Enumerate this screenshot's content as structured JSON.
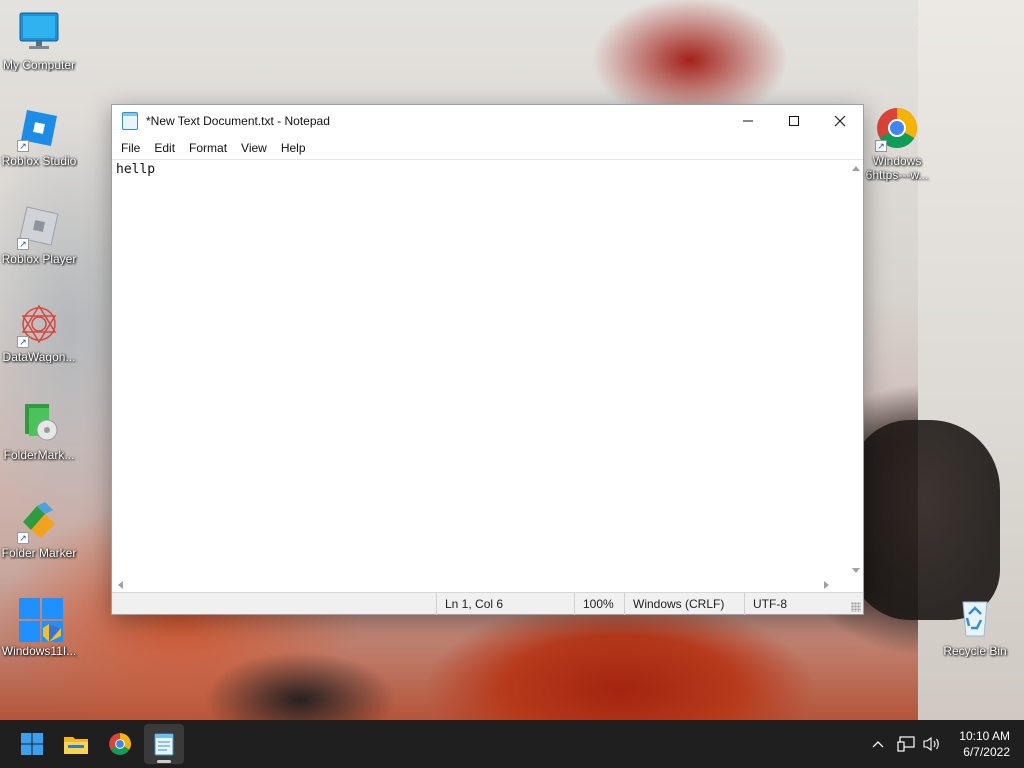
{
  "desktop": {
    "icons_left": [
      {
        "label": "My Computer",
        "icon": "monitor-icon"
      },
      {
        "label": "Roblox Studio",
        "icon": "roblox-studio-icon"
      },
      {
        "label": "Roblox Player",
        "icon": "roblox-player-icon"
      },
      {
        "label": "DataWagon...",
        "icon": "datawagon-icon"
      },
      {
        "label": "FolderMark...",
        "icon": "foldermarker-icon"
      },
      {
        "label": "Folder Marker",
        "icon": "folder-marker-icon"
      },
      {
        "label": "Windows11I...",
        "icon": "windows-logo-icon"
      }
    ],
    "icons_right": [
      {
        "label_line1": "Windows",
        "label_line2": "6https---w...",
        "icon": "chrome-icon"
      },
      {
        "label": "Recycle Bin",
        "icon": "recycle-bin-icon"
      }
    ]
  },
  "notepad": {
    "title": "*New Text Document.txt - Notepad",
    "menu": [
      "File",
      "Edit",
      "Format",
      "View",
      "Help"
    ],
    "content": "hellp",
    "status": {
      "position": "Ln 1, Col 6",
      "zoom": "100%",
      "line_ending": "Windows (CRLF)",
      "encoding": "UTF-8"
    }
  },
  "taskbar": {
    "apps": [
      "start-icon",
      "file-explorer-icon",
      "chrome-icon",
      "notepad-icon"
    ],
    "active_app": "notepad-icon",
    "tray_icons": [
      "chevron-up-icon",
      "network-icon",
      "speaker-icon"
    ],
    "time": "10:10 AM",
    "date": "6/7/2022"
  },
  "colors": {
    "taskbar_bg": "#1f1f1f",
    "chrome_red": "#db4437",
    "chrome_yellow": "#f4b400",
    "chrome_green": "#0f9d58",
    "chrome_blue": "#4285f4",
    "windows_blue": "#1e90ff"
  }
}
